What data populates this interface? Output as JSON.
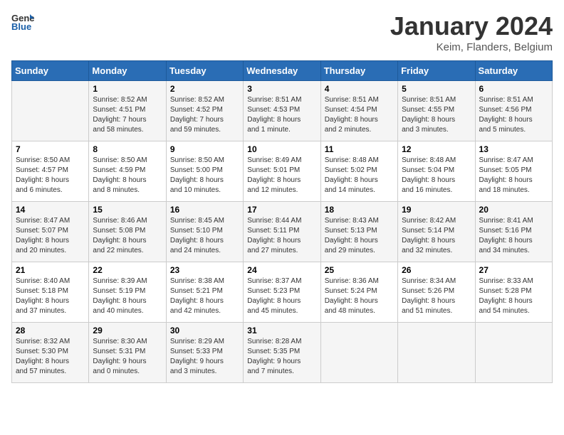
{
  "header": {
    "logo_line1": "General",
    "logo_line2": "Blue",
    "month_title": "January 2024",
    "subtitle": "Keim, Flanders, Belgium"
  },
  "days_of_week": [
    "Sunday",
    "Monday",
    "Tuesday",
    "Wednesday",
    "Thursday",
    "Friday",
    "Saturday"
  ],
  "weeks": [
    [
      {
        "day": "",
        "info": ""
      },
      {
        "day": "1",
        "info": "Sunrise: 8:52 AM\nSunset: 4:51 PM\nDaylight: 7 hours\nand 58 minutes."
      },
      {
        "day": "2",
        "info": "Sunrise: 8:52 AM\nSunset: 4:52 PM\nDaylight: 7 hours\nand 59 minutes."
      },
      {
        "day": "3",
        "info": "Sunrise: 8:51 AM\nSunset: 4:53 PM\nDaylight: 8 hours\nand 1 minute."
      },
      {
        "day": "4",
        "info": "Sunrise: 8:51 AM\nSunset: 4:54 PM\nDaylight: 8 hours\nand 2 minutes."
      },
      {
        "day": "5",
        "info": "Sunrise: 8:51 AM\nSunset: 4:55 PM\nDaylight: 8 hours\nand 3 minutes."
      },
      {
        "day": "6",
        "info": "Sunrise: 8:51 AM\nSunset: 4:56 PM\nDaylight: 8 hours\nand 5 minutes."
      }
    ],
    [
      {
        "day": "7",
        "info": "Sunrise: 8:50 AM\nSunset: 4:57 PM\nDaylight: 8 hours\nand 6 minutes."
      },
      {
        "day": "8",
        "info": "Sunrise: 8:50 AM\nSunset: 4:59 PM\nDaylight: 8 hours\nand 8 minutes."
      },
      {
        "day": "9",
        "info": "Sunrise: 8:50 AM\nSunset: 5:00 PM\nDaylight: 8 hours\nand 10 minutes."
      },
      {
        "day": "10",
        "info": "Sunrise: 8:49 AM\nSunset: 5:01 PM\nDaylight: 8 hours\nand 12 minutes."
      },
      {
        "day": "11",
        "info": "Sunrise: 8:48 AM\nSunset: 5:02 PM\nDaylight: 8 hours\nand 14 minutes."
      },
      {
        "day": "12",
        "info": "Sunrise: 8:48 AM\nSunset: 5:04 PM\nDaylight: 8 hours\nand 16 minutes."
      },
      {
        "day": "13",
        "info": "Sunrise: 8:47 AM\nSunset: 5:05 PM\nDaylight: 8 hours\nand 18 minutes."
      }
    ],
    [
      {
        "day": "14",
        "info": "Sunrise: 8:47 AM\nSunset: 5:07 PM\nDaylight: 8 hours\nand 20 minutes."
      },
      {
        "day": "15",
        "info": "Sunrise: 8:46 AM\nSunset: 5:08 PM\nDaylight: 8 hours\nand 22 minutes."
      },
      {
        "day": "16",
        "info": "Sunrise: 8:45 AM\nSunset: 5:10 PM\nDaylight: 8 hours\nand 24 minutes."
      },
      {
        "day": "17",
        "info": "Sunrise: 8:44 AM\nSunset: 5:11 PM\nDaylight: 8 hours\nand 27 minutes."
      },
      {
        "day": "18",
        "info": "Sunrise: 8:43 AM\nSunset: 5:13 PM\nDaylight: 8 hours\nand 29 minutes."
      },
      {
        "day": "19",
        "info": "Sunrise: 8:42 AM\nSunset: 5:14 PM\nDaylight: 8 hours\nand 32 minutes."
      },
      {
        "day": "20",
        "info": "Sunrise: 8:41 AM\nSunset: 5:16 PM\nDaylight: 8 hours\nand 34 minutes."
      }
    ],
    [
      {
        "day": "21",
        "info": "Sunrise: 8:40 AM\nSunset: 5:18 PM\nDaylight: 8 hours\nand 37 minutes."
      },
      {
        "day": "22",
        "info": "Sunrise: 8:39 AM\nSunset: 5:19 PM\nDaylight: 8 hours\nand 40 minutes."
      },
      {
        "day": "23",
        "info": "Sunrise: 8:38 AM\nSunset: 5:21 PM\nDaylight: 8 hours\nand 42 minutes."
      },
      {
        "day": "24",
        "info": "Sunrise: 8:37 AM\nSunset: 5:23 PM\nDaylight: 8 hours\nand 45 minutes."
      },
      {
        "day": "25",
        "info": "Sunrise: 8:36 AM\nSunset: 5:24 PM\nDaylight: 8 hours\nand 48 minutes."
      },
      {
        "day": "26",
        "info": "Sunrise: 8:34 AM\nSunset: 5:26 PM\nDaylight: 8 hours\nand 51 minutes."
      },
      {
        "day": "27",
        "info": "Sunrise: 8:33 AM\nSunset: 5:28 PM\nDaylight: 8 hours\nand 54 minutes."
      }
    ],
    [
      {
        "day": "28",
        "info": "Sunrise: 8:32 AM\nSunset: 5:30 PM\nDaylight: 8 hours\nand 57 minutes."
      },
      {
        "day": "29",
        "info": "Sunrise: 8:30 AM\nSunset: 5:31 PM\nDaylight: 9 hours\nand 0 minutes."
      },
      {
        "day": "30",
        "info": "Sunrise: 8:29 AM\nSunset: 5:33 PM\nDaylight: 9 hours\nand 3 minutes."
      },
      {
        "day": "31",
        "info": "Sunrise: 8:28 AM\nSunset: 5:35 PM\nDaylight: 9 hours\nand 7 minutes."
      },
      {
        "day": "",
        "info": ""
      },
      {
        "day": "",
        "info": ""
      },
      {
        "day": "",
        "info": ""
      }
    ]
  ]
}
